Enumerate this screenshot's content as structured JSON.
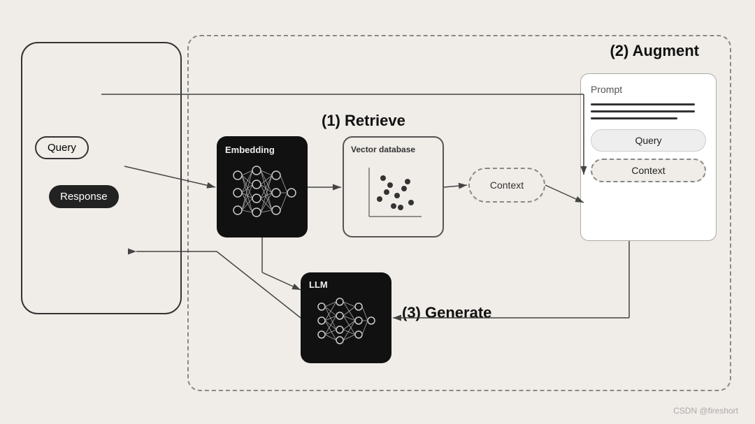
{
  "diagram": {
    "background_color": "#f0ede8",
    "watermark": "CSDN @fireshort",
    "chat": {
      "query_label": "Query",
      "response_label": "Response"
    },
    "sections": {
      "retrieve": {
        "label": "(1) Retrieve",
        "number": "1"
      },
      "augment": {
        "label": "(2) Augment",
        "number": "2"
      },
      "generate": {
        "label": "(3) Generate",
        "number": "3"
      }
    },
    "boxes": {
      "embedding": {
        "title": "Embedding"
      },
      "vector_db": {
        "title": "Vector database"
      },
      "llm": {
        "title": "LLM"
      },
      "prompt": {
        "title": "Prompt"
      }
    },
    "labels": {
      "context": "Context",
      "query": "Query",
      "context_pill": "Context"
    }
  }
}
